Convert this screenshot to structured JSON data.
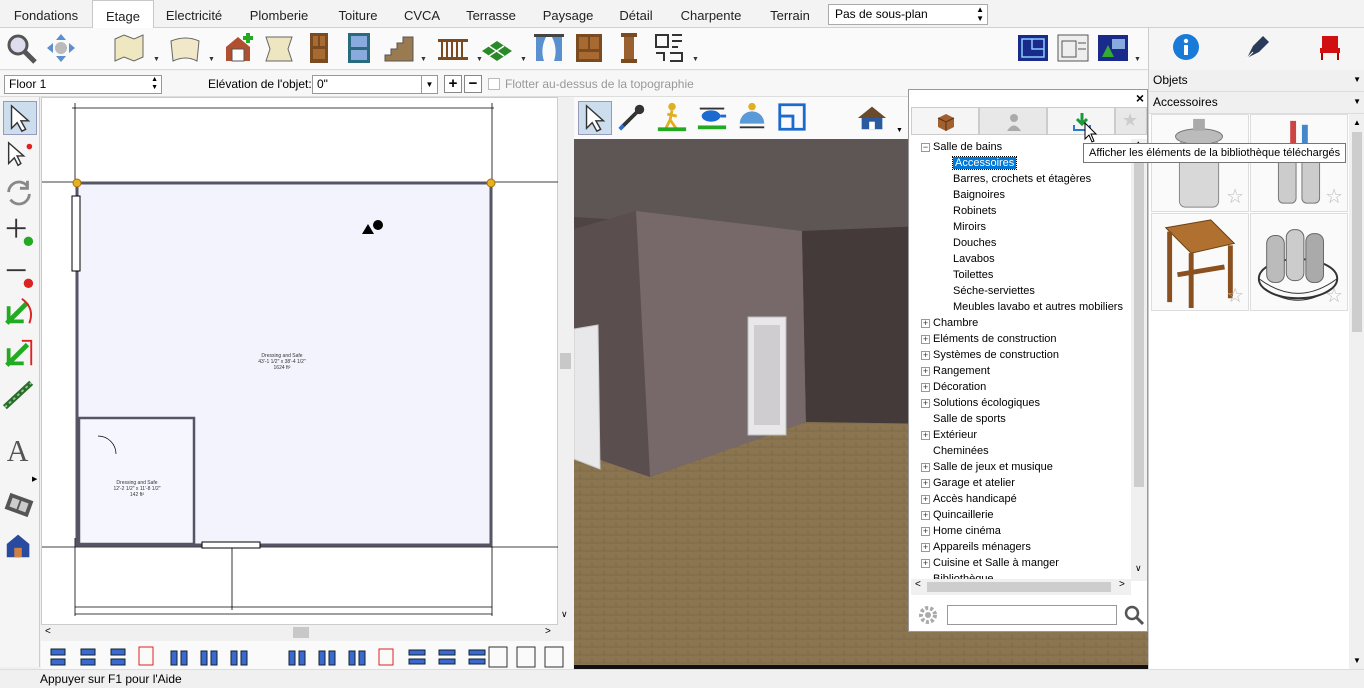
{
  "tabs": [
    {
      "label": "Fondations"
    },
    {
      "label": "Etage",
      "active": true
    },
    {
      "label": "Electricité"
    },
    {
      "label": "Plomberie"
    },
    {
      "label": "Toiture"
    },
    {
      "label": "CVCA"
    },
    {
      "label": "Terrasse"
    },
    {
      "label": "Paysage"
    },
    {
      "label": "Détail"
    },
    {
      "label": "Charpente"
    },
    {
      "label": "Terrain"
    }
  ],
  "subplan_select": "Pas de sous-plan",
  "toolbar2": {
    "floor": "Floor 1",
    "elevation_label": "Elévation de l'objet:",
    "elevation_value": "0\"",
    "plus": "+",
    "minus": "−",
    "float_label": "Flotter au-dessus de la topographie"
  },
  "plan": {
    "room1": {
      "name": "Dressing and Safe",
      "dims": "43'-1 1/2\" x 38'-4 1/2\"",
      "area": "1624 ft²"
    },
    "room2": {
      "name": "Dressing and Safe",
      "dims": "12'-2 1/2\" x 11'-8 1/2\"",
      "area": "142 ft²"
    }
  },
  "library": {
    "close": "×",
    "root": "Salle de bains",
    "children": [
      "Accessoires",
      "Barres, crochets et étagères",
      "Baignoires",
      "Robinets",
      "Miroirs",
      "Douches",
      "Lavabos",
      "Toilettes",
      "Séche-serviettes",
      "Meubles lavabo et autres mobiliers"
    ],
    "selected": "Accessoires",
    "categories": [
      "Chambre",
      "Eléments de construction",
      "Systèmes de construction",
      "Rangement",
      "Décoration",
      "Solutions écologiques",
      "Salle de sports",
      "Extérieur",
      "Cheminées",
      "Salle de jeux et musique",
      "Garage et atelier",
      "Accès handicapé",
      "Quincaillerie",
      "Home cinéma",
      "Appareils ménagers",
      "Cuisine et Salle à manger",
      "Bibliothèque"
    ],
    "expandable": [
      true,
      true,
      true,
      true,
      true,
      true,
      false,
      true,
      false,
      true,
      true,
      true,
      true,
      true,
      true,
      true,
      false
    ],
    "search_placeholder": ""
  },
  "tooltip": "Afficher les éléments de la bibliothèque téléchargés",
  "right_panel": {
    "select1": "Objets",
    "select2": "Accessoires"
  },
  "status": "Appuyer sur F1 pour l'Aide",
  "colors": {
    "accent": "#0078d7",
    "wall": "#5a5a7a",
    "floor3d": "#8a7550"
  }
}
